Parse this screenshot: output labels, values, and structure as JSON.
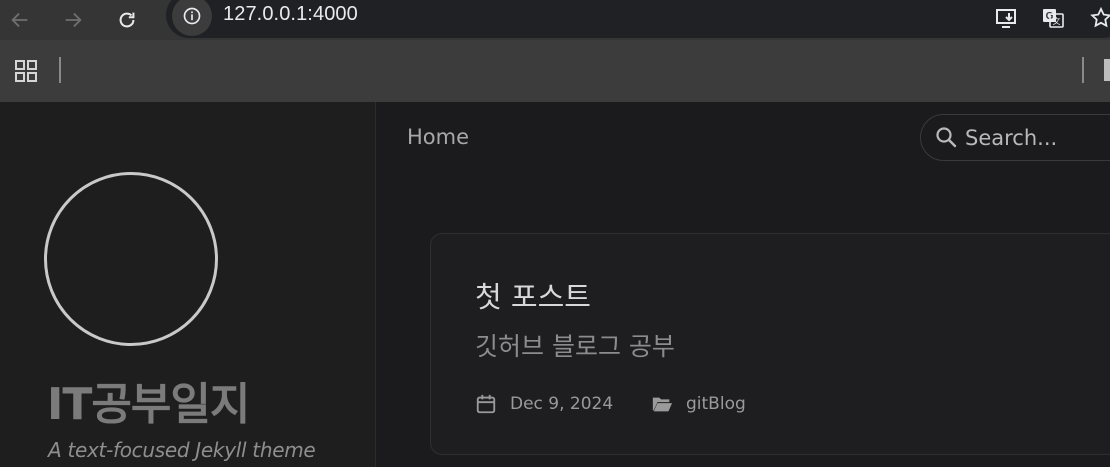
{
  "browser": {
    "url": "127.0.0.1:4000",
    "icons": [
      "back-arrow-icon",
      "forward-arrow-icon",
      "reload-icon",
      "site-info-icon",
      "install-app-icon",
      "translate-icon",
      "bookmark-star-icon",
      "apps-grid-icon"
    ]
  },
  "sidebar": {
    "title": "IT공부일지",
    "subtitle": "A text-focused Jekyll theme"
  },
  "topbar": {
    "home_label": "Home",
    "search_placeholder": "Search..."
  },
  "post": {
    "title": "첫 포스트",
    "description": "깃허브 블로그 공부",
    "date": "Dec 9, 2024",
    "category": "gitBlog"
  },
  "colors": {
    "background": "#1b1b1e",
    "sidebar": "#1e1e1e",
    "chrome": "#3c3c3c"
  }
}
